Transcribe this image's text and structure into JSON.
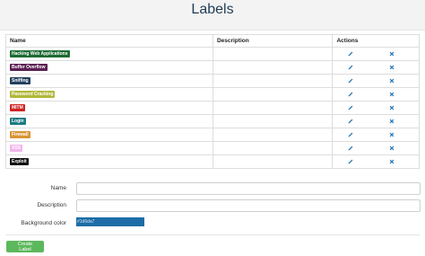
{
  "page": {
    "title": "Labels"
  },
  "table": {
    "columns": {
      "name": "Name",
      "description": "Description",
      "actions": "Actions"
    },
    "rows": [
      {
        "name": "Hacking Web Applications",
        "color": "#1e6b32",
        "description": ""
      },
      {
        "name": "Buffer Overflow",
        "color": "#5a1f52",
        "description": ""
      },
      {
        "name": "Sniffing",
        "color": "#22405e",
        "description": ""
      },
      {
        "name": "Password Cracking",
        "color": "#b1b83a",
        "description": ""
      },
      {
        "name": "MITM",
        "color": "#cf2424",
        "description": ""
      },
      {
        "name": "Login",
        "color": "#1b7a83",
        "description": ""
      },
      {
        "name": "Firewall",
        "color": "#d99435",
        "description": ""
      },
      {
        "name": "XSS",
        "color": "#f3b5ec",
        "description": ""
      },
      {
        "name": "Exploit",
        "color": "#111111",
        "description": ""
      }
    ],
    "icons": {
      "edit": "pencil-icon",
      "delete": "close-icon",
      "accent": "#2b7bb9"
    }
  },
  "form": {
    "name_label": "Name",
    "description_label": "Description",
    "background_label": "Background color",
    "name_value": "",
    "description_value": "",
    "background_value": "#1d6da7",
    "background_text": "#1d6da7",
    "create_button": "Create Label"
  }
}
